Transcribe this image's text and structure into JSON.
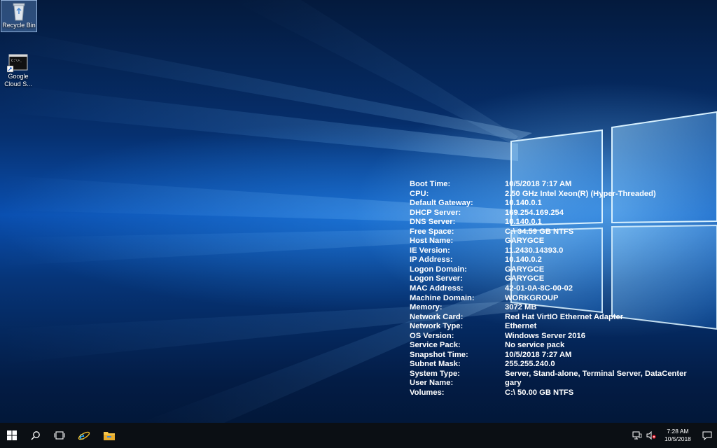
{
  "desktop": {
    "icons": [
      {
        "label": "Recycle Bin",
        "icon": "recycle-bin-icon"
      },
      {
        "label_line1": "Google",
        "label_line2": "Cloud S...",
        "icon": "google-cloud-sdk-shell-icon"
      }
    ]
  },
  "bginfo": {
    "rows": [
      {
        "key": "Boot Time:",
        "value": "10/5/2018 7:17 AM"
      },
      {
        "key": "CPU:",
        "value": "2.50 GHz Intel Xeon(R) (Hyper-Threaded)"
      },
      {
        "key": "Default Gateway:",
        "value": "10.140.0.1"
      },
      {
        "key": "DHCP Server:",
        "value": "169.254.169.254"
      },
      {
        "key": "DNS Server:",
        "value": "10.140.0.1"
      },
      {
        "key": "Free Space:",
        "value": "C:\\ 34.59 GB NTFS"
      },
      {
        "key": "Host Name:",
        "value": "GARYGCE"
      },
      {
        "key": "IE Version:",
        "value": "11.2430.14393.0"
      },
      {
        "key": "IP Address:",
        "value": "10.140.0.2"
      },
      {
        "key": "Logon Domain:",
        "value": "GARYGCE"
      },
      {
        "key": "Logon Server:",
        "value": "GARYGCE"
      },
      {
        "key": "MAC Address:",
        "value": "42-01-0A-8C-00-02"
      },
      {
        "key": "Machine Domain:",
        "value": "WORKGROUP"
      },
      {
        "key": "Memory:",
        "value": "3072 MB"
      },
      {
        "key": "Network Card:",
        "value": "Red Hat VirtIO Ethernet Adapter"
      },
      {
        "key": "Network Type:",
        "value": "Ethernet"
      },
      {
        "key": "OS Version:",
        "value": "Windows Server 2016"
      },
      {
        "key": "Service Pack:",
        "value": "No service pack"
      },
      {
        "key": "Snapshot Time:",
        "value": "10/5/2018 7:27 AM"
      },
      {
        "key": "Subnet Mask:",
        "value": "255.255.240.0"
      },
      {
        "key": "System Type:",
        "value": "Server, Stand-alone, Terminal Server, DataCenter"
      },
      {
        "key": "User Name:",
        "value": "gary"
      },
      {
        "key": "Volumes:",
        "value": "C:\\ 50.00 GB NTFS"
      }
    ]
  },
  "taskbar": {
    "buttons": [
      "windows-start-icon",
      "search-icon",
      "task-view-icon",
      "internet-explorer-icon",
      "file-explorer-icon"
    ],
    "tray": {
      "time": "7:28 AM",
      "date": "10/5/2018",
      "icons": [
        "network-icon",
        "volume-muted-icon",
        "action-center-icon"
      ]
    }
  },
  "colors": {
    "taskbar": "#0b0f14",
    "ie_blue": "#1ea1f1",
    "folder_yellow": "#f7c64a"
  }
}
